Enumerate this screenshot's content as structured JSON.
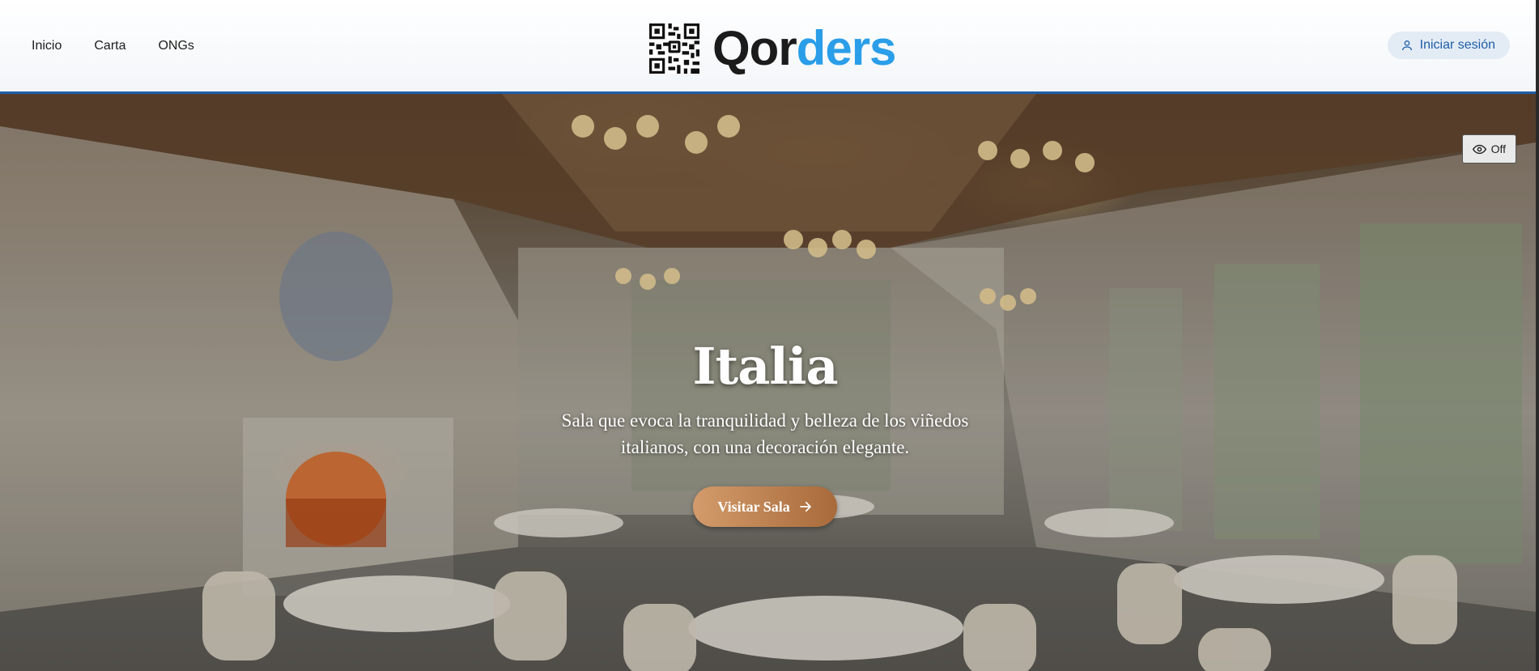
{
  "nav": {
    "items": [
      {
        "label": "Inicio"
      },
      {
        "label": "Carta"
      },
      {
        "label": "ONGs"
      }
    ]
  },
  "brand": {
    "wordmark_part1": "Qor",
    "wordmark_part2": "ders",
    "icon": "qr-code-icon"
  },
  "login": {
    "label": "Iniciar sesión",
    "icon": "user-icon"
  },
  "vision_toggle": {
    "label": "Off",
    "icon": "eye-icon"
  },
  "hero": {
    "title": "Italia",
    "subtitle": "Sala que evoca la tranquilidad y belleza de los viñedos italianos, con una decoración elegante.",
    "button_label": "Visitar Sala",
    "button_icon": "arrow-right-icon"
  },
  "colors": {
    "accent_blue": "#2a9ee8",
    "header_border": "#1f5fa8",
    "button_gradient_start": "#d39b6b",
    "button_gradient_end": "#a86a3a"
  }
}
